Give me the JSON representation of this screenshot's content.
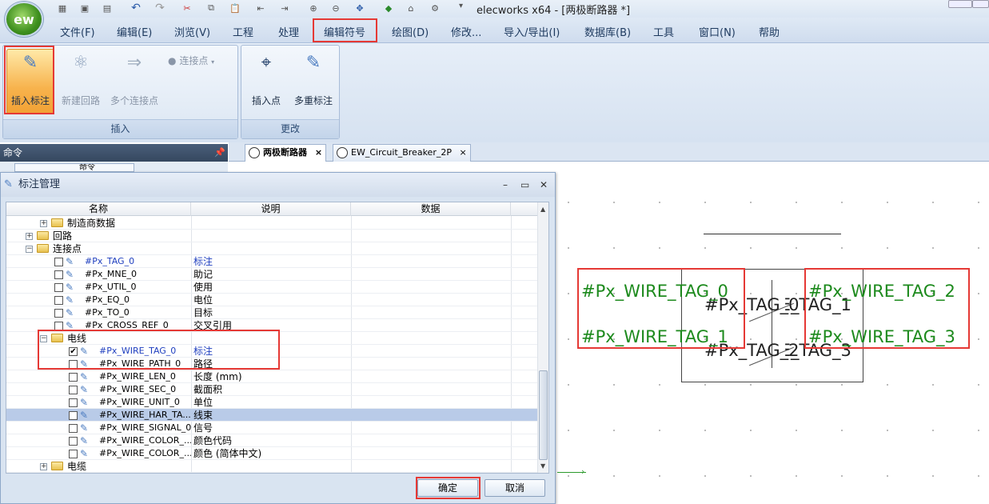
{
  "app": {
    "title": "elecworks x64 - [两极断路器 *]",
    "logo": "ew"
  },
  "quick_access": [
    "new-icon",
    "save-icon",
    "save-all-icon",
    "undo-icon",
    "redo-icon",
    "cut-icon",
    "copy-icon",
    "paste-icon",
    "back-icon",
    "forward-icon",
    "zoom-in-icon",
    "zoom-out-icon",
    "pan-icon",
    "run-icon",
    "tool-icon",
    "settings-icon"
  ],
  "menu": [
    "文件(F)",
    "编辑(E)",
    "浏览(V)",
    "工程",
    "处理",
    "编辑符号",
    "绘图(D)",
    "修改...",
    "导入/导出(I)",
    "数据库(B)",
    "工具",
    "窗口(N)",
    "帮助"
  ],
  "ribbon": {
    "insert_group": {
      "label": "插入",
      "insert_tag": "插入标注",
      "new_circuit": "新建回路",
      "multi_connect": "多个连接点",
      "connect_point": "连接点"
    },
    "change_group": {
      "label": "更改",
      "insert_point": "插入点",
      "multi_tag": "多重标注"
    }
  },
  "cmd_pane": {
    "title": "命令",
    "pin": "ᵖ",
    "sub": "命令"
  },
  "tabs": [
    {
      "label": "两极断路器",
      "close": "×"
    },
    {
      "label": "EW_Circuit_Breaker_2P",
      "close": "×"
    }
  ],
  "dialog": {
    "title": "标注管理",
    "columns": [
      "名称",
      "说明",
      "数据"
    ],
    "rows": [
      {
        "name": "制造商数据",
        "desc": "",
        "kind": "folder",
        "level": 2,
        "exp": "+"
      },
      {
        "name": "回路",
        "desc": "",
        "kind": "folder",
        "level": 1,
        "exp": "+"
      },
      {
        "name": "连接点",
        "desc": "",
        "kind": "folder",
        "level": 1,
        "exp": "−"
      },
      {
        "name": "#Px_TAG_0",
        "desc": "标注",
        "kind": "tag",
        "level": 3,
        "checked": false,
        "blue": true
      },
      {
        "name": "#Px_MNE_0",
        "desc": "助记",
        "kind": "tag",
        "level": 3,
        "checked": false
      },
      {
        "name": "#Px_UTIL_0",
        "desc": "使用",
        "kind": "tag",
        "level": 3,
        "checked": false
      },
      {
        "name": "#Px_EQ_0",
        "desc": "电位",
        "kind": "tag",
        "level": 3,
        "checked": false
      },
      {
        "name": "#Px_TO_0",
        "desc": "目标",
        "kind": "tag",
        "level": 3,
        "checked": false
      },
      {
        "name": "#Px_CROSS_REF_0",
        "desc": "交叉引用",
        "kind": "tag",
        "level": 3,
        "checked": false
      },
      {
        "name": "电线",
        "desc": "",
        "kind": "folder",
        "level": 2,
        "exp": "−"
      },
      {
        "name": "#Px_WIRE_TAG_0",
        "desc": "标注",
        "kind": "tag",
        "level": 4,
        "checked": true,
        "blue": true
      },
      {
        "name": "#Px_WIRE_PATH_0",
        "desc": "路径",
        "kind": "tag",
        "level": 4,
        "checked": false
      },
      {
        "name": "#Px_WIRE_LEN_0",
        "desc": "长度 (mm)",
        "kind": "tag",
        "level": 4,
        "checked": false
      },
      {
        "name": "#Px_WIRE_SEC_0",
        "desc": "截面积",
        "kind": "tag",
        "level": 4,
        "checked": false
      },
      {
        "name": "#Px_WIRE_UNIT_0",
        "desc": "单位",
        "kind": "tag",
        "level": 4,
        "checked": false
      },
      {
        "name": "#Px_WIRE_HAR_TA...",
        "desc": "线束",
        "kind": "tag",
        "level": 4,
        "checked": false,
        "selected": true
      },
      {
        "name": "#Px_WIRE_SIGNAL_0",
        "desc": "信号",
        "kind": "tag",
        "level": 4,
        "checked": false
      },
      {
        "name": "#Px_WIRE_COLOR_...",
        "desc": "颜色代码",
        "kind": "tag",
        "level": 4,
        "checked": false
      },
      {
        "name": "#Px_WIRE_COLOR_...",
        "desc": "颜色 (简体中文)",
        "kind": "tag",
        "level": 4,
        "checked": false
      },
      {
        "name": "电缆",
        "desc": "",
        "kind": "folder",
        "level": 2,
        "exp": "+"
      }
    ],
    "ok": "确定",
    "cancel": "取消"
  },
  "canvas": {
    "wire_tags": [
      "#Px_WIRE_TAG_0",
      "#Px_WIRE_TAG_2",
      "#Px_WIRE_TAG_1",
      "#Px_WIRE_TAG_3"
    ],
    "overlap_top": "#Px_TAG_0",
    "overlap_bottom": "#Px_TAG_2"
  },
  "colors": {
    "highlight": "#e53935",
    "tag_text": "#1d8a1d",
    "blue_text": "#1f3fbf"
  }
}
